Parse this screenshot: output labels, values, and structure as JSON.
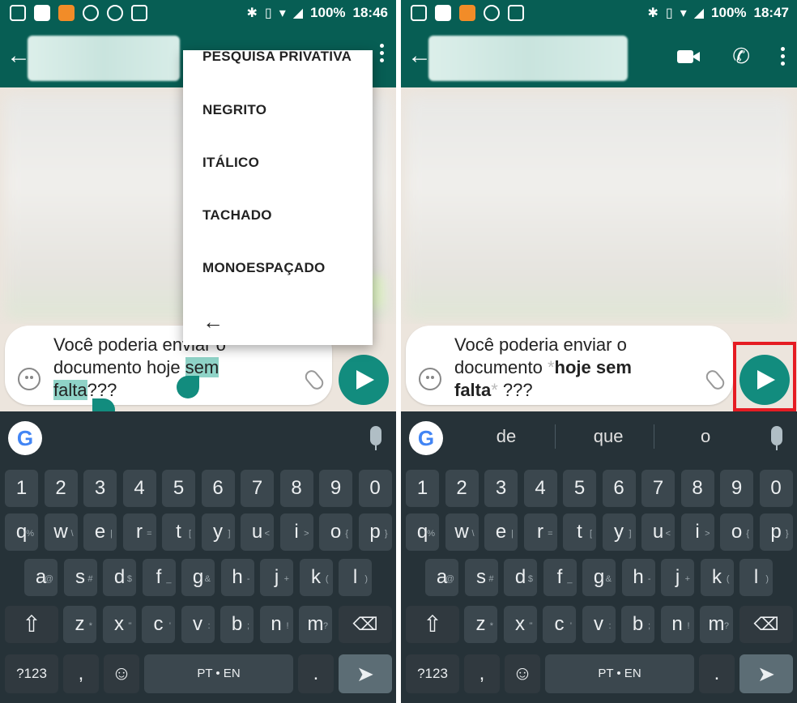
{
  "status_left": {
    "time": "18:46",
    "battery": "100%"
  },
  "status_right": {
    "time": "18:47",
    "battery": "100%"
  },
  "menu": {
    "items": [
      "PESQUISA PRIVATIVA",
      "NEGRITO",
      "ITÁLICO",
      "TACHADO",
      "MONOESPAÇADO"
    ],
    "back_icon": "arrow-left-icon"
  },
  "left_message": {
    "line1": "Você poderia enviar o",
    "line2_plain": "documento hoje ",
    "line2_selected": "sem",
    "line3_selected": "falta",
    "line3_rest": "???"
  },
  "right_message": {
    "line1": "Você poderia enviar o",
    "line2_plain": "documento ",
    "marker_open": "*",
    "line2_bold": "hoje sem",
    "line3_bold": "falta",
    "marker_close": "*",
    "line3_rest": " ???"
  },
  "keyboard": {
    "suggestions": [
      "de",
      "que",
      "o"
    ],
    "row_numbers": [
      "1",
      "2",
      "3",
      "4",
      "5",
      "6",
      "7",
      "8",
      "9",
      "0"
    ],
    "row1": [
      "q",
      "w",
      "e",
      "r",
      "t",
      "y",
      "u",
      "i",
      "o",
      "p"
    ],
    "row1_alt": [
      "%",
      "\\",
      "|",
      "=",
      "[",
      "]",
      "<",
      ">",
      "{",
      "}"
    ],
    "row2": [
      "a",
      "s",
      "d",
      "f",
      "g",
      "h",
      "j",
      "k",
      "l"
    ],
    "row2_alt": [
      "@",
      "#",
      "$",
      "_",
      "&",
      "-",
      "+",
      "(",
      ")"
    ],
    "row3": [
      "z",
      "x",
      "c",
      "v",
      "b",
      "n",
      "m"
    ],
    "row3_alt": [
      "*",
      "\"",
      "'",
      ":",
      ";",
      "!",
      "?"
    ],
    "symbols_label": "?123",
    "comma_label": ",",
    "space_label": "PT • EN",
    "period_label": "."
  },
  "colors": {
    "header": "#075e54",
    "accent": "#128c7e",
    "keyboard": "#263238",
    "highlight": "#e51c23"
  }
}
